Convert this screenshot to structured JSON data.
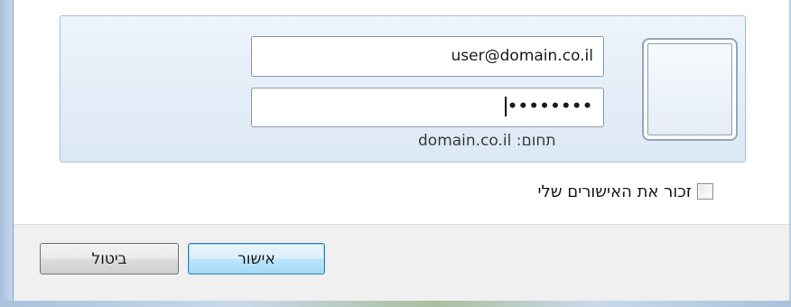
{
  "credential": {
    "username_value": "user@domain.co.il",
    "password_mask": "••••••••",
    "domain_label": "תחום: domain.co.il"
  },
  "remember": {
    "label": "זכור את האישורים שלי",
    "checked": false
  },
  "buttons": {
    "ok_label": "אישור",
    "cancel_label": "ביטול"
  },
  "colors": {
    "tile_bg": "#dce8f5",
    "tile_border": "#a5bfdf",
    "ok_button_border": "#3c7fb1",
    "footer_bg": "#f0f0f0"
  }
}
